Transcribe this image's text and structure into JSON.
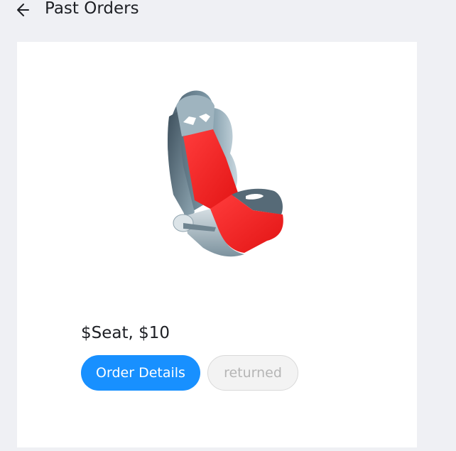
{
  "header": {
    "title": "Past Orders",
    "back_icon": "arrow-left-icon"
  },
  "order": {
    "image_name": "car-seat-image",
    "title": "$Seat, $10",
    "details_button_label": "Order Details",
    "status": "returned"
  },
  "colors": {
    "background": "#eff0f4",
    "card": "#ffffff",
    "primary": "#1890ff",
    "status_badge_bg": "#f3f3f3",
    "status_badge_text": "#b5b5b5"
  }
}
